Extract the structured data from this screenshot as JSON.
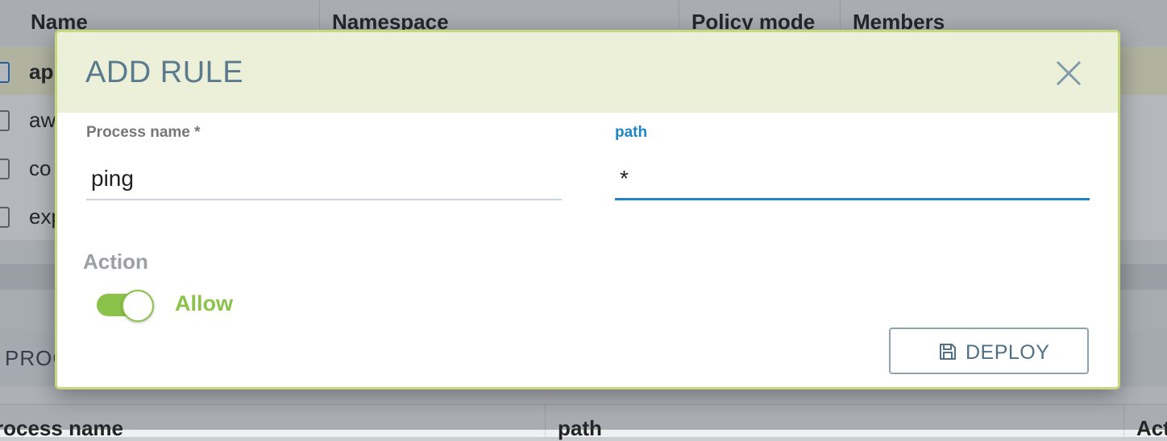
{
  "background": {
    "table_headers": [
      "Name",
      "Namespace",
      "Policy mode",
      "Members"
    ],
    "rows": [
      "ap",
      "aw",
      "co",
      "exp"
    ],
    "section_title": "PROC",
    "bottom_headers": [
      "rocess name",
      "path",
      "Act"
    ]
  },
  "dialog": {
    "title": "ADD RULE",
    "process_name": {
      "label": "Process name *",
      "value": "ping"
    },
    "path": {
      "label": "path",
      "value": "*"
    },
    "action": {
      "label": "Action",
      "toggle_label": "Allow",
      "enabled": true
    },
    "deploy_label": "DEPLOY"
  },
  "colors": {
    "header_bg": "#edf0d8",
    "dialog_border": "#c5d87d",
    "accent_green": "#8bc34a",
    "active_blue": "#1e86c8",
    "title_color": "#5a7a8e"
  },
  "icons": [
    "close-icon",
    "save-icon"
  ]
}
